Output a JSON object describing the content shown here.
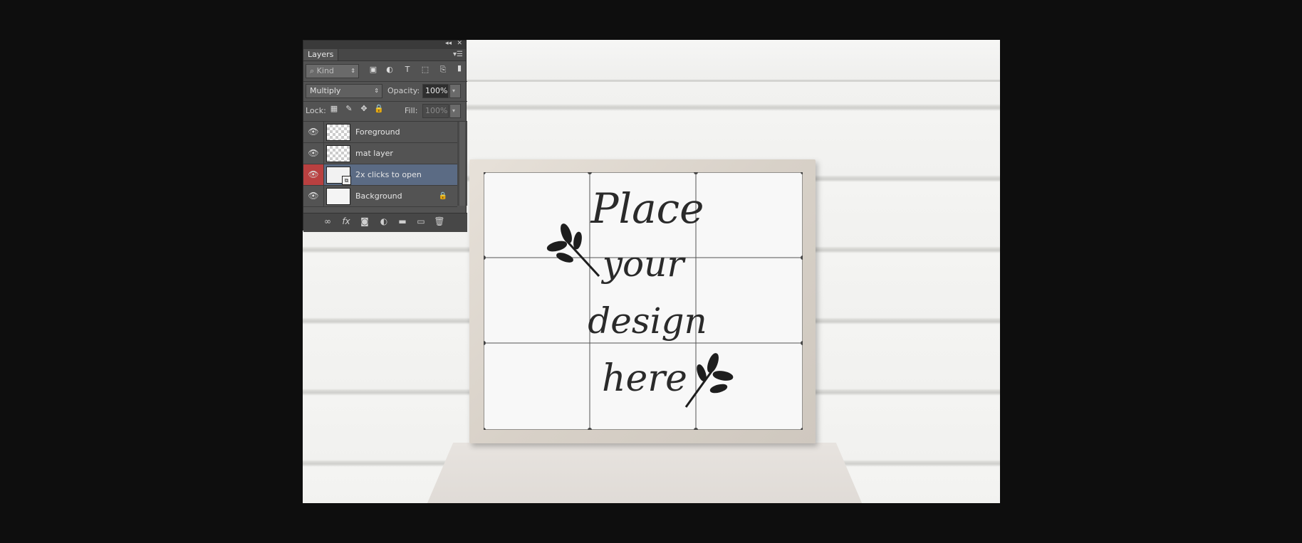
{
  "canvas": {
    "design_text": [
      "Place",
      "your",
      "design",
      "here"
    ]
  },
  "panel": {
    "tab": "Layers",
    "filter_kind": "Kind",
    "blend_mode": "Multiply",
    "opacity_label": "Opacity:",
    "opacity_value": "100%",
    "lock_label": "Lock:",
    "fill_label": "Fill:",
    "fill_value": "100%",
    "layers": [
      {
        "name": "Foreground",
        "visible": true,
        "selected": false,
        "locked": false
      },
      {
        "name": "mat layer",
        "visible": true,
        "selected": false,
        "locked": false
      },
      {
        "name": "2x clicks to open",
        "visible": true,
        "selected": true,
        "locked": false
      },
      {
        "name": "Background",
        "visible": true,
        "selected": false,
        "locked": true
      }
    ],
    "colors": {
      "panel_bg": "#535353",
      "selected_row": "#5b6b84",
      "eye_highlight": "#b94040"
    }
  }
}
